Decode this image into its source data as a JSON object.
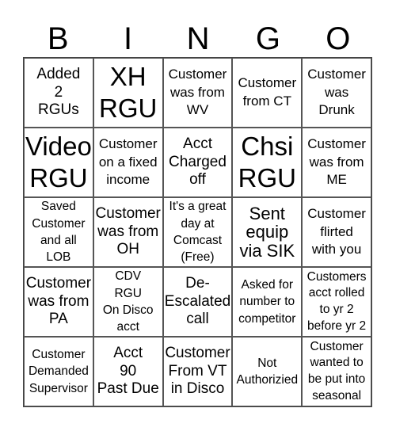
{
  "header": {
    "letters": [
      "B",
      "I",
      "N",
      "G",
      "O"
    ]
  },
  "cells": [
    "Added\n2\nRGUs",
    "XH\nRGU",
    "Customer\nwas from\nWV",
    "Customer\nfrom CT",
    "Customer\nwas\nDrunk",
    "Video\nRGU",
    "Customer\non a fixed\nincome",
    "Acct\nCharged\noff",
    "Chsi\nRGU",
    "Customer\nwas from\nME",
    "Saved\nCustomer\nand all\nLOB",
    "Customer\nwas from\nOH",
    "It's a great\nday at\nComcast\n(Free)",
    "Sent\nequip\nvia SIK",
    "Customer\nflirted\nwith you",
    "Customer\nwas from\nPA",
    "CDV\nRGU\nOn Disco\nacct",
    "De-\nEscalated\ncall",
    "Asked for\nnumber to\ncompetitor",
    "Customers\nacct rolled\nto yr 2\nbefore yr 2",
    "Customer\nDemanded\nSupervisor",
    "Acct\n90\nPast Due",
    "Customer\nFrom VT\nin Disco",
    "Not\nAuthorizied",
    "Customer\nwanted to\nbe put into\nseasonal"
  ]
}
